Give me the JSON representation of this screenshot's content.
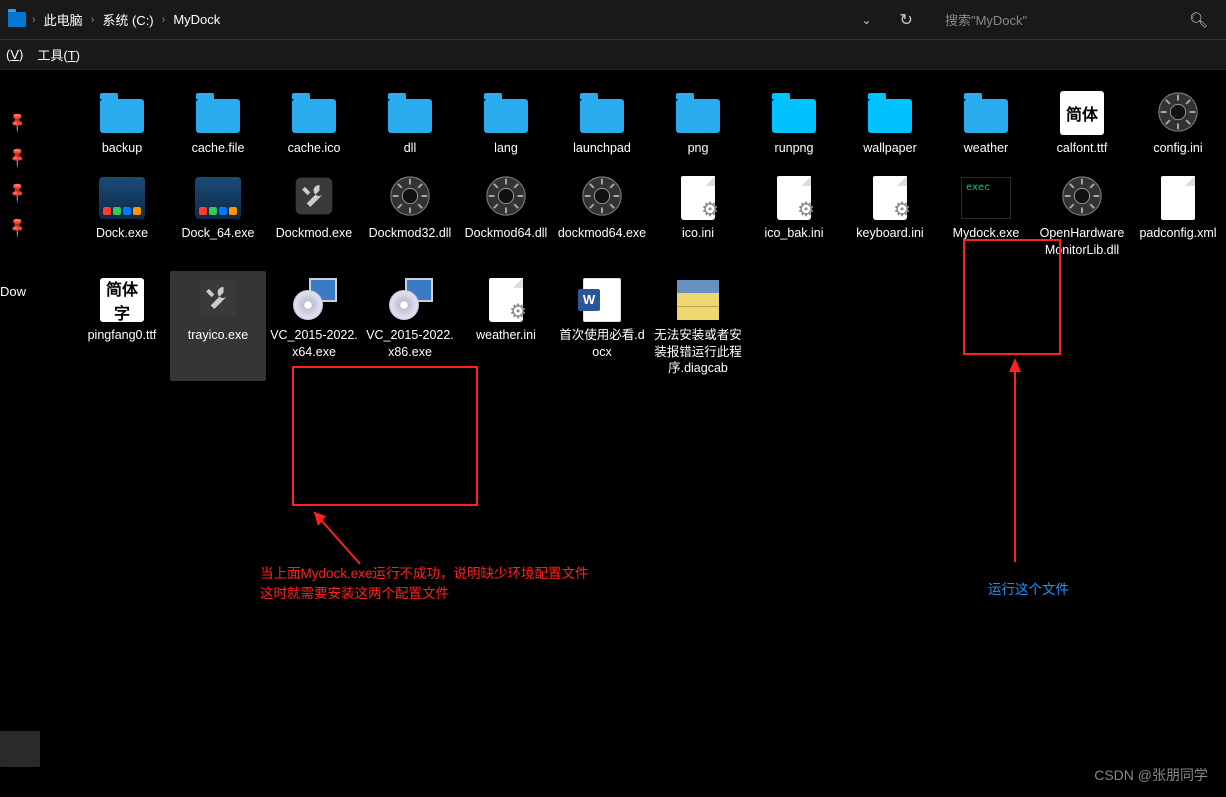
{
  "breadcrumb": {
    "items": [
      "此电脑",
      "系统 (C:)",
      "MyDock"
    ]
  },
  "search": {
    "placeholder": "搜索\"MyDock\""
  },
  "menubar": {
    "view_prefix": "(",
    "view_key": "V",
    "view_suffix": ")",
    "tools_prefix": "工具(",
    "tools_key": "T",
    "tools_suffix": ")"
  },
  "leftover": {
    "dow": "Dow"
  },
  "files": [
    {
      "name": "backup",
      "type": "folder"
    },
    {
      "name": "cache.file",
      "type": "folder"
    },
    {
      "name": "cache.ico",
      "type": "folder"
    },
    {
      "name": "dll",
      "type": "folder"
    },
    {
      "name": "lang",
      "type": "folder"
    },
    {
      "name": "launchpad",
      "type": "folder"
    },
    {
      "name": "png",
      "type": "folder"
    },
    {
      "name": "runpng",
      "type": "folder-bright"
    },
    {
      "name": "wallpaper",
      "type": "folder-bright"
    },
    {
      "name": "weather",
      "type": "folder"
    },
    {
      "name": "calfont.ttf",
      "type": "ttf",
      "glyph": "简体"
    },
    {
      "name": "config.ini",
      "type": "gear"
    },
    {
      "name": "Dock.exe",
      "type": "dockexe"
    },
    {
      "name": "Dock_64.exe",
      "type": "dockexe"
    },
    {
      "name": "Dockmod.exe",
      "type": "wrench"
    },
    {
      "name": "Dockmod32.dll",
      "type": "cog"
    },
    {
      "name": "Dockmod64.dll",
      "type": "cog"
    },
    {
      "name": "dockmod64.exe",
      "type": "cog"
    },
    {
      "name": "ico.ini",
      "type": "page-cog"
    },
    {
      "name": "ico_bak.ini",
      "type": "page-cog"
    },
    {
      "name": "keyboard.ini",
      "type": "page-cog"
    },
    {
      "name": "Mydock.exe",
      "type": "exec",
      "glyph": "exec"
    },
    {
      "name": "OpenHardwareMonitorLib.dll",
      "type": "cog"
    },
    {
      "name": "padconfig.xml",
      "type": "xml"
    },
    {
      "name": "pingfang0.ttf",
      "type": "ttf",
      "glyph": "简体字"
    },
    {
      "name": "trayico.exe",
      "type": "wrench",
      "selected": true
    },
    {
      "name": "VC_2015-2022.x64.exe",
      "type": "installer"
    },
    {
      "name": "VC_2015-2022.x86.exe",
      "type": "installer"
    },
    {
      "name": "weather.ini",
      "type": "page-cog"
    },
    {
      "name": "首次使用必看.docx",
      "type": "word"
    },
    {
      "name": "无法安装或者安装报错运行此程序.diagcab",
      "type": "cab"
    }
  ],
  "annotations": {
    "red_text_line1": "当上面Mydock.exe运行不成功，说明缺少环境配置文件",
    "red_text_line2": "这时就需要安装这两个配置文件",
    "blue_text": "运行这个文件"
  },
  "watermark": "CSDN @张朋同学"
}
